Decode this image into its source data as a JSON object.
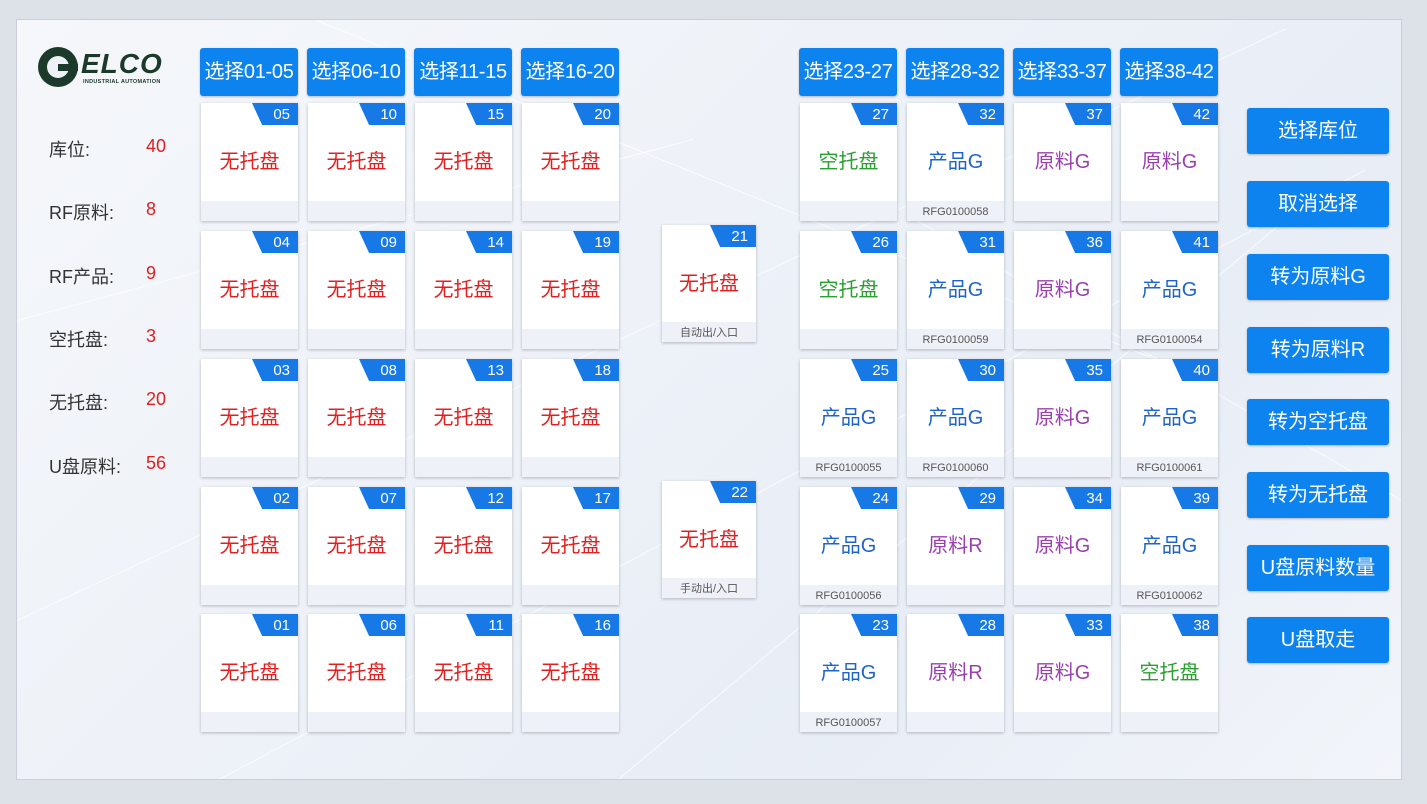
{
  "stats": [
    {
      "label": "库位:",
      "value": "40"
    },
    {
      "label": "RF原料:",
      "value": "8"
    },
    {
      "label": "RF产品:",
      "value": "9"
    },
    {
      "label": "空托盘:",
      "value": "3"
    },
    {
      "label": "无托盘:",
      "value": "20"
    },
    {
      "label": "U盘原料:",
      "value": "56"
    }
  ],
  "logo": {
    "text": "ELCO",
    "sub": "INDUSTRIAL AUTOMATION"
  },
  "select_buttons": [
    "选择01-05",
    "选择06-10",
    "选择11-15",
    "选择16-20",
    "选择23-27",
    "选择28-32",
    "选择33-37",
    "选择38-42"
  ],
  "cards": [
    {
      "num": "05",
      "status": "无托盘",
      "kind": "none",
      "sub": ""
    },
    {
      "num": "10",
      "status": "无托盘",
      "kind": "none",
      "sub": ""
    },
    {
      "num": "15",
      "status": "无托盘",
      "kind": "none",
      "sub": ""
    },
    {
      "num": "20",
      "status": "无托盘",
      "kind": "none",
      "sub": ""
    },
    {
      "num": "27",
      "status": "空托盘",
      "kind": "empty",
      "sub": ""
    },
    {
      "num": "32",
      "status": "产品G",
      "kind": "prod",
      "sub": "RFG0100058"
    },
    {
      "num": "37",
      "status": "原料G",
      "kind": "rawg",
      "sub": ""
    },
    {
      "num": "42",
      "status": "原料G",
      "kind": "rawg",
      "sub": ""
    },
    {
      "num": "04",
      "status": "无托盘",
      "kind": "none",
      "sub": ""
    },
    {
      "num": "09",
      "status": "无托盘",
      "kind": "none",
      "sub": ""
    },
    {
      "num": "14",
      "status": "无托盘",
      "kind": "none",
      "sub": ""
    },
    {
      "num": "19",
      "status": "无托盘",
      "kind": "none",
      "sub": ""
    },
    {
      "num": "26",
      "status": "空托盘",
      "kind": "empty",
      "sub": ""
    },
    {
      "num": "31",
      "status": "产品G",
      "kind": "prod",
      "sub": "RFG0100059"
    },
    {
      "num": "36",
      "status": "原料G",
      "kind": "rawg",
      "sub": ""
    },
    {
      "num": "41",
      "status": "产品G",
      "kind": "prod",
      "sub": "RFG0100054"
    },
    {
      "num": "03",
      "status": "无托盘",
      "kind": "none",
      "sub": ""
    },
    {
      "num": "08",
      "status": "无托盘",
      "kind": "none",
      "sub": ""
    },
    {
      "num": "13",
      "status": "无托盘",
      "kind": "none",
      "sub": ""
    },
    {
      "num": "18",
      "status": "无托盘",
      "kind": "none",
      "sub": ""
    },
    {
      "num": "25",
      "status": "产品G",
      "kind": "prod",
      "sub": "RFG0100055"
    },
    {
      "num": "30",
      "status": "产品G",
      "kind": "prod",
      "sub": "RFG0100060"
    },
    {
      "num": "35",
      "status": "原料G",
      "kind": "rawg",
      "sub": ""
    },
    {
      "num": "40",
      "status": "产品G",
      "kind": "prod",
      "sub": "RFG0100061"
    },
    {
      "num": "02",
      "status": "无托盘",
      "kind": "none",
      "sub": ""
    },
    {
      "num": "07",
      "status": "无托盘",
      "kind": "none",
      "sub": ""
    },
    {
      "num": "12",
      "status": "无托盘",
      "kind": "none",
      "sub": ""
    },
    {
      "num": "17",
      "status": "无托盘",
      "kind": "none",
      "sub": ""
    },
    {
      "num": "24",
      "status": "产品G",
      "kind": "prod",
      "sub": "RFG0100056"
    },
    {
      "num": "29",
      "status": "原料R",
      "kind": "rawr",
      "sub": ""
    },
    {
      "num": "34",
      "status": "原料G",
      "kind": "rawg",
      "sub": ""
    },
    {
      "num": "39",
      "status": "产品G",
      "kind": "prod",
      "sub": "RFG0100062"
    },
    {
      "num": "01",
      "status": "无托盘",
      "kind": "none",
      "sub": ""
    },
    {
      "num": "06",
      "status": "无托盘",
      "kind": "none",
      "sub": ""
    },
    {
      "num": "11",
      "status": "无托盘",
      "kind": "none",
      "sub": ""
    },
    {
      "num": "16",
      "status": "无托盘",
      "kind": "none",
      "sub": ""
    },
    {
      "num": "23",
      "status": "产品G",
      "kind": "prod",
      "sub": "RFG0100057"
    },
    {
      "num": "28",
      "status": "原料R",
      "kind": "rawr",
      "sub": ""
    },
    {
      "num": "33",
      "status": "原料G",
      "kind": "rawg",
      "sub": ""
    },
    {
      "num": "38",
      "status": "空托盘",
      "kind": "empty",
      "sub": ""
    }
  ],
  "io_cards": [
    {
      "num": "21",
      "status": "无托盘",
      "kind": "none",
      "sub": "自动出/入口"
    },
    {
      "num": "22",
      "status": "无托盘",
      "kind": "none",
      "sub": "手动出/入口"
    }
  ],
  "side_buttons": [
    "选择库位",
    "取消选择",
    "转为原料G",
    "转为原料R",
    "转为空托盘",
    "转为无托盘",
    "U盘原料数量",
    "U盘取走"
  ],
  "colors": {
    "accent": "#0d83f0",
    "tag": "#1679e6",
    "none": "#e02020",
    "empty": "#2aa030",
    "product": "#1c64c9",
    "raw": "#9a3fae"
  }
}
